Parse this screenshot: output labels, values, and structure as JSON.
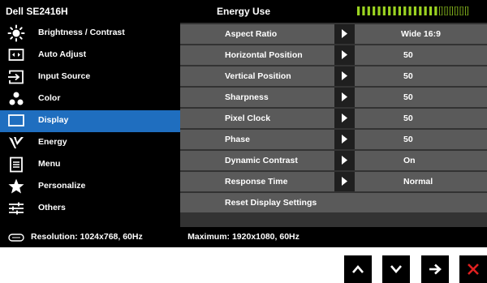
{
  "header": {
    "model": "Dell SE2416H",
    "title": "Energy Use",
    "energy_level": 0.73,
    "energy_bar_color": "#9bd321"
  },
  "colors": {
    "active_menu": "#1f6ebf",
    "row_bg": "#5a5a5a",
    "close_x": "#e02020"
  },
  "sidebar": {
    "items": [
      {
        "label": "Brightness / Contrast",
        "icon": "brightness-icon"
      },
      {
        "label": "Auto Adjust",
        "icon": "auto-adjust-icon"
      },
      {
        "label": "Input Source",
        "icon": "input-source-icon"
      },
      {
        "label": "Color",
        "icon": "color-icon"
      },
      {
        "label": "Display",
        "icon": "display-icon",
        "active": true
      },
      {
        "label": "Energy",
        "icon": "energy-icon"
      },
      {
        "label": "Menu",
        "icon": "menu-icon"
      },
      {
        "label": "Personalize",
        "icon": "personalize-icon"
      },
      {
        "label": "Others",
        "icon": "others-icon"
      }
    ]
  },
  "settings": {
    "rows": [
      {
        "label": "Aspect Ratio",
        "value": "Wide 16:9"
      },
      {
        "label": "Horizontal Position",
        "value": "50"
      },
      {
        "label": "Vertical Position",
        "value": "50"
      },
      {
        "label": "Sharpness",
        "value": "50"
      },
      {
        "label": "Pixel Clock",
        "value": "50"
      },
      {
        "label": "Phase",
        "value": "50"
      },
      {
        "label": "Dynamic Contrast",
        "value": "On"
      },
      {
        "label": "Response Time",
        "value": "Normal"
      },
      {
        "label": "Reset Display Settings"
      }
    ]
  },
  "status": {
    "resolution": "Resolution: 1024x768, 60Hz",
    "maximum": "Maximum: 1920x1080, 60Hz"
  },
  "nav_buttons": [
    "up-icon",
    "down-icon",
    "right-arrow-icon",
    "close-icon"
  ]
}
